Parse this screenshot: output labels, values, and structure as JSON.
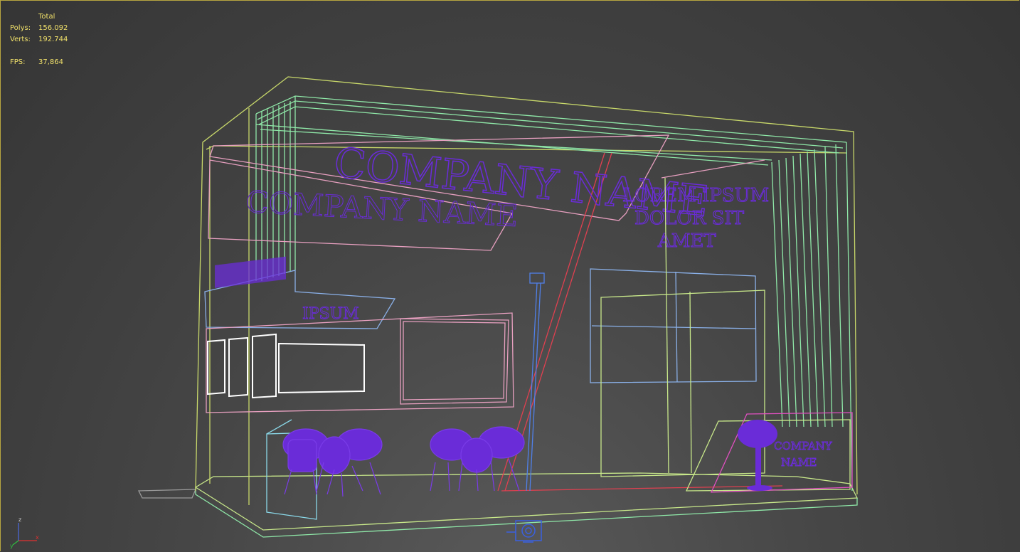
{
  "stats": {
    "header": "Total",
    "polys_label": "Polys:",
    "polys_value": "156.092",
    "verts_label": "Verts:",
    "verts_value": "192.744",
    "fps_label": "FPS:",
    "fps_value": "37,864"
  },
  "scene": {
    "top_sign": "COMPANY NAME",
    "wall_sign": "COMPANY NAME",
    "right_sign_line1": "LOREM IPSUM",
    "right_sign_line2": "DOLOR SIT",
    "right_sign_line3": "AMET",
    "counter_sign": "IPSUM",
    "kiosk_sign_line1": "COMPANY",
    "kiosk_sign_line2": "NAME"
  },
  "colors": {
    "background": "#464646",
    "stats_text": "#f0e06a",
    "wire_green": "#8fe8a8",
    "wire_yellow": "#c8d86a",
    "wire_pink": "#e8a0c0",
    "wire_blue": "#8ab0e8",
    "wire_red": "#e04050",
    "furniture": "#6a2cd8"
  },
  "axis": {
    "x": "x",
    "y": "y",
    "z": "z"
  }
}
